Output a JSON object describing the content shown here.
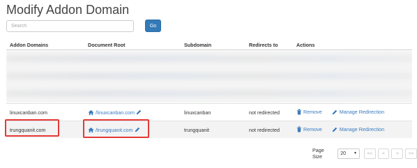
{
  "page": {
    "title": "Modify Addon Domain"
  },
  "search": {
    "placeholder": "Search",
    "value": "",
    "go_label": "Go"
  },
  "table": {
    "headers": {
      "domain": "Addon Domains",
      "root": "Document Root",
      "subdomain": "Subdomain",
      "redirects": "Redirects to",
      "actions": "Actions"
    },
    "rows": [
      {
        "domain": "linuxcanban.com",
        "root": "/linuxcanban.com",
        "subdomain": "linuxcanban",
        "redirects": "not redirected",
        "remove": "Remove",
        "manage": "Manage Redirection"
      },
      {
        "domain": "trungquanit.com",
        "root": "/trungquanit.com",
        "subdomain": "trungquanit",
        "redirects": "not redirected",
        "remove": "Remove",
        "manage": "Manage Redirection"
      }
    ]
  },
  "pagination": {
    "page_size_label": "Page Size",
    "page_size": "20",
    "first": "<<",
    "prev": "<",
    "next": ">",
    "last": ">>"
  },
  "colors": {
    "accent": "#337ab7",
    "link": "#3a7bbf",
    "highlight": "#e53935"
  },
  "icons": {
    "home": "home-icon",
    "edit": "pencil-icon",
    "remove": "trash-icon",
    "manage": "pencil-icon"
  }
}
